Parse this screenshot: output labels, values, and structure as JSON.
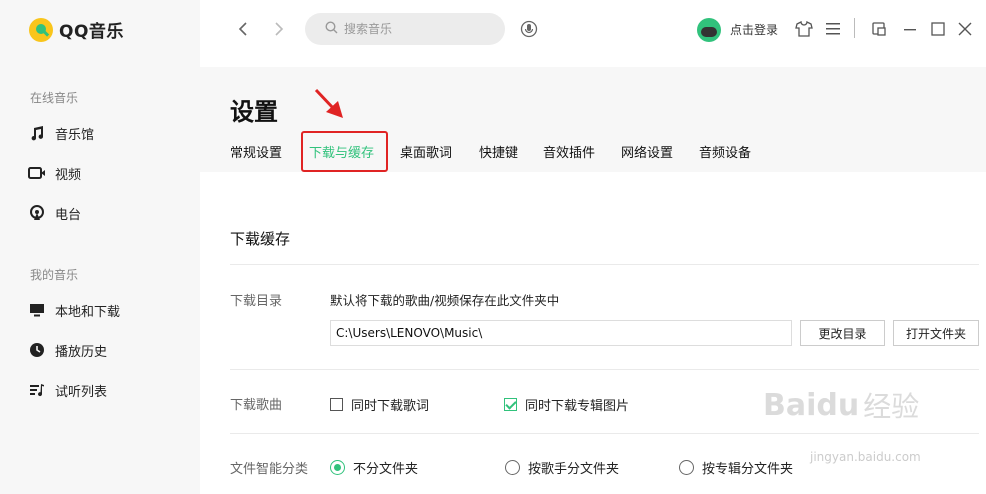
{
  "app": {
    "logo_text": "QQ音乐"
  },
  "sidebar": {
    "online_title": "在线音乐",
    "online_items": [
      {
        "label": "音乐馆",
        "icon": "music-note-icon"
      },
      {
        "label": "视频",
        "icon": "video-icon"
      },
      {
        "label": "电台",
        "icon": "radio-icon"
      }
    ],
    "mine_title": "我的音乐",
    "mine_items": [
      {
        "label": "本地和下载",
        "icon": "monitor-icon"
      },
      {
        "label": "播放历史",
        "icon": "history-icon"
      },
      {
        "label": "试听列表",
        "icon": "playlist-icon"
      }
    ]
  },
  "topbar": {
    "search_placeholder": "搜索音乐",
    "login_label": "点击登录"
  },
  "settings": {
    "title": "设置",
    "tabs": [
      "常规设置",
      "下载与缓存",
      "桌面歌词",
      "快捷键",
      "音效插件",
      "网络设置",
      "音频设备"
    ],
    "active_tab": "下载与缓存",
    "section_title": "下载缓存",
    "download_dir": {
      "label": "下载目录",
      "description": "默认将下载的歌曲/视频保存在此文件夹中",
      "path": "C:\\Users\\LENOVO\\Music\\",
      "change_button": "更改目录",
      "open_button": "打开文件夹"
    },
    "download_songs": {
      "label": "下载歌曲",
      "lyrics_option": "同时下载歌词",
      "lyrics_checked": false,
      "cover_option": "同时下载专辑图片",
      "cover_checked": true
    },
    "smart_folder": {
      "label": "文件智能分类",
      "options": [
        "不分文件夹",
        "按歌手分文件夹",
        "按专辑分文件夹"
      ],
      "selected": "不分文件夹"
    }
  },
  "watermark": {
    "logo": "Bai",
    "paw": "du",
    "text": "经验",
    "url": "jingyan.baidu.com"
  },
  "colors": {
    "accent": "#31c27c",
    "highlight": "#e02424",
    "sidebar_bg": "#f7f7f7"
  }
}
